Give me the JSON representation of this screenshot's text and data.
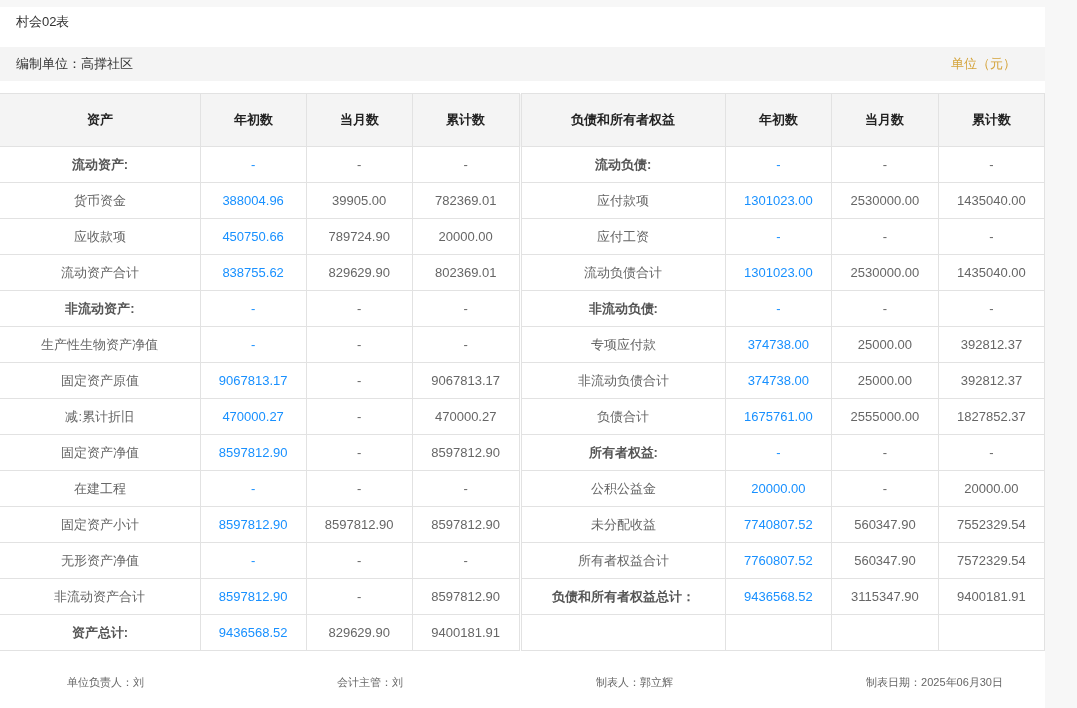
{
  "form_code": "村会02表",
  "info_bar": {
    "unit_label": "编制单位：高撑社区",
    "currency": "单位（元）"
  },
  "columns": {
    "left": [
      "资产",
      "年初数",
      "当月数",
      "累计数"
    ],
    "right": [
      "负债和所有者权益",
      "年初数",
      "当月数",
      "累计数"
    ]
  },
  "rows": [
    {
      "left": {
        "kind": "heading",
        "label": "流动资产:",
        "opening": "-",
        "month": "-",
        "total": "-"
      },
      "right": {
        "kind": "heading",
        "label": "流动负债:",
        "opening": "-",
        "month": "-",
        "total": "-"
      }
    },
    {
      "left": {
        "kind": "item",
        "label": "货币资金",
        "opening": "388004.96",
        "month": "39905.00",
        "total": "782369.01"
      },
      "right": {
        "kind": "item",
        "label": "应付款项",
        "opening": "1301023.00",
        "month": "2530000.00",
        "total": "1435040.00"
      }
    },
    {
      "left": {
        "kind": "item",
        "label": "应收款项",
        "opening": "450750.66",
        "month": "789724.90",
        "total": "20000.00"
      },
      "right": {
        "kind": "item",
        "label": "应付工资",
        "opening": "-",
        "month": "-",
        "total": "-"
      }
    },
    {
      "left": {
        "kind": "item",
        "label": "流动资产合计",
        "opening": "838755.62",
        "month": "829629.90",
        "total": "802369.01"
      },
      "right": {
        "kind": "item",
        "label": "流动负债合计",
        "opening": "1301023.00",
        "month": "2530000.00",
        "total": "1435040.00"
      }
    },
    {
      "left": {
        "kind": "heading",
        "label": "非流动资产:",
        "opening": "-",
        "month": "-",
        "total": "-"
      },
      "right": {
        "kind": "heading",
        "label": "非流动负债:",
        "opening": "-",
        "month": "-",
        "total": "-"
      }
    },
    {
      "left": {
        "kind": "item",
        "label": "生产性生物资产净值",
        "opening": "-",
        "month": "-",
        "total": "-"
      },
      "right": {
        "kind": "item",
        "label": "专项应付款",
        "opening": "374738.00",
        "month": "25000.00",
        "total": "392812.37"
      }
    },
    {
      "left": {
        "kind": "item",
        "label": "固定资产原值",
        "opening": "9067813.17",
        "month": "-",
        "total": "9067813.17"
      },
      "right": {
        "kind": "item",
        "label": "非流动负债合计",
        "opening": "374738.00",
        "month": "25000.00",
        "total": "392812.37"
      }
    },
    {
      "left": {
        "kind": "item",
        "label": "减:累计折旧",
        "opening": "470000.27",
        "month": "-",
        "total": "470000.27"
      },
      "right": {
        "kind": "item",
        "label": "负债合计",
        "opening": "1675761.00",
        "month": "2555000.00",
        "total": "1827852.37"
      }
    },
    {
      "left": {
        "kind": "item",
        "label": "固定资产净值",
        "opening": "8597812.90",
        "month": "-",
        "total": "8597812.90"
      },
      "right": {
        "kind": "heading",
        "label": "所有者权益:",
        "opening": "-",
        "month": "-",
        "total": "-"
      }
    },
    {
      "left": {
        "kind": "item",
        "label": "在建工程",
        "opening": "-",
        "month": "-",
        "total": "-"
      },
      "right": {
        "kind": "item",
        "label": "公积公益金",
        "opening": "20000.00",
        "month": "-",
        "total": "20000.00"
      }
    },
    {
      "left": {
        "kind": "item",
        "label": "固定资产小计",
        "opening": "8597812.90",
        "month": "8597812.90",
        "total": "8597812.90"
      },
      "right": {
        "kind": "item",
        "label": "未分配收益",
        "opening": "7740807.52",
        "month": "560347.90",
        "total": "7552329.54"
      }
    },
    {
      "left": {
        "kind": "item",
        "label": "无形资产净值",
        "opening": "-",
        "month": "-",
        "total": "-"
      },
      "right": {
        "kind": "item",
        "label": "所有者权益合计",
        "opening": "7760807.52",
        "month": "560347.90",
        "total": "7572329.54"
      }
    },
    {
      "left": {
        "kind": "item",
        "label": "非流动资产合计",
        "opening": "8597812.90",
        "month": "-",
        "total": "8597812.90"
      },
      "right": {
        "kind": "heading",
        "label": "负债和所有者权益总计：",
        "opening": "9436568.52",
        "month": "3115347.90",
        "total": "9400181.91"
      }
    },
    {
      "left": {
        "kind": "heading",
        "label": "资产总计:",
        "opening": "9436568.52",
        "month": "829629.90",
        "total": "9400181.91"
      }
    }
  ],
  "footer": [
    "单位负责人：刘",
    "会计主管：刘",
    "制表人：郭立辉",
    "制表日期：2025年06月30日"
  ]
}
